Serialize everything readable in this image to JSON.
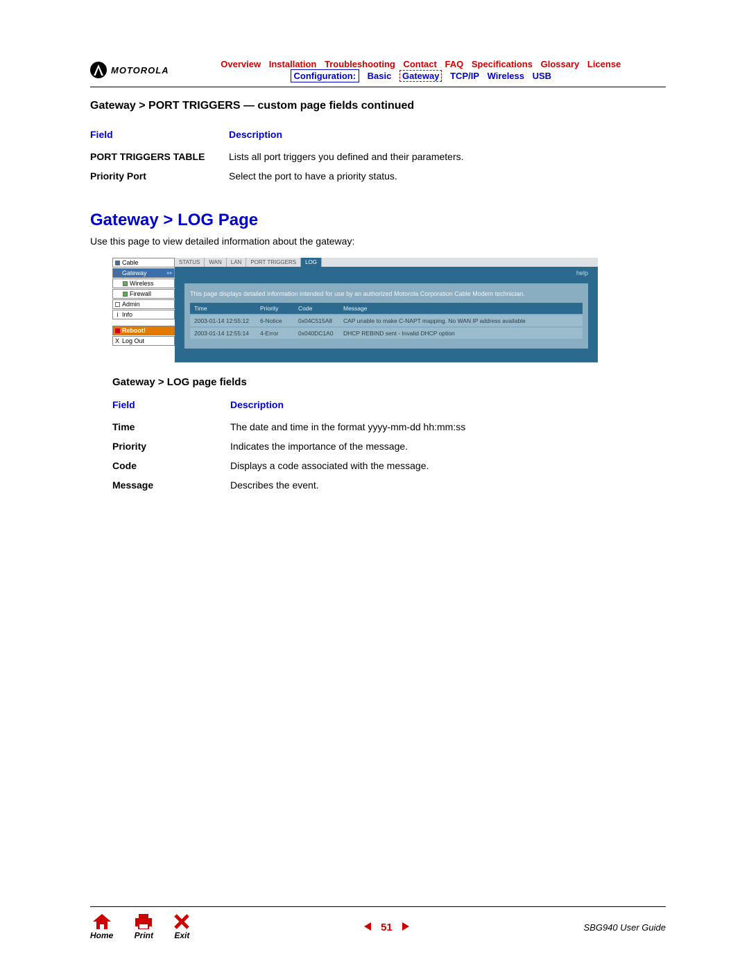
{
  "brand": "MOTOROLA",
  "topnav": [
    "Overview",
    "Installation",
    "Troubleshooting",
    "Contact",
    "FAQ",
    "Specifications",
    "Glossary",
    "License"
  ],
  "subnav": {
    "label": "Configuration:",
    "items": [
      "Basic",
      "Gateway",
      "TCP/IP",
      "Wireless",
      "USB"
    ],
    "dashed_index": 1
  },
  "section1": {
    "heading": "Gateway > PORT TRIGGERS — custom page fields continued",
    "th_field": "Field",
    "th_desc": "Description",
    "rows": [
      {
        "f": "PORT TRIGGERS TABLE",
        "d": "Lists all port triggers you defined and their parameters."
      },
      {
        "f": "Priority Port",
        "d": "Select the port to have a priority status."
      }
    ]
  },
  "page_title": "Gateway > LOG Page",
  "intro": "Use this page to view detailed information about the gateway:",
  "ui": {
    "sidebar": [
      "Cable",
      "Gateway",
      "Wireless",
      "Firewall",
      "Admin",
      "Info",
      "Reboot!",
      "Log Out"
    ],
    "tabs": [
      "STATUS",
      "WAN",
      "LAN",
      "PORT TRIGGERS",
      "LOG"
    ],
    "help": "help",
    "panel_text": "This page displays detailed information intended for use by an authorized Motorola Corporation Cable Modem technician.",
    "cols": [
      "Time",
      "Priority",
      "Code",
      "Message"
    ],
    "rows": [
      {
        "t": "2003-01-14 12:55:12",
        "p": "6-Notice",
        "c": "0x04C515A8",
        "m": "CAP unable to make C-NAPT mapping. No WAN IP address available"
      },
      {
        "t": "2003-01-14 12:55:14",
        "p": "4-Error",
        "c": "0x040DC1A0",
        "m": "DHCP REBIND sent - Invalid DHCP option"
      }
    ]
  },
  "section2": {
    "heading": "Gateway > LOG page fields",
    "th_field": "Field",
    "th_desc": "Description",
    "rows": [
      {
        "f": "Time",
        "d": "The date and time in the format yyyy-mm-dd hh:mm:ss"
      },
      {
        "f": "Priority",
        "d": "Indicates the importance of the message."
      },
      {
        "f": "Code",
        "d": "Displays a code associated with the message."
      },
      {
        "f": "Message",
        "d": "Describes the event."
      }
    ]
  },
  "footer": {
    "icons": [
      {
        "name": "Home"
      },
      {
        "name": "Print"
      },
      {
        "name": "Exit"
      }
    ],
    "page": "51",
    "guide": "SBG940 User Guide"
  }
}
